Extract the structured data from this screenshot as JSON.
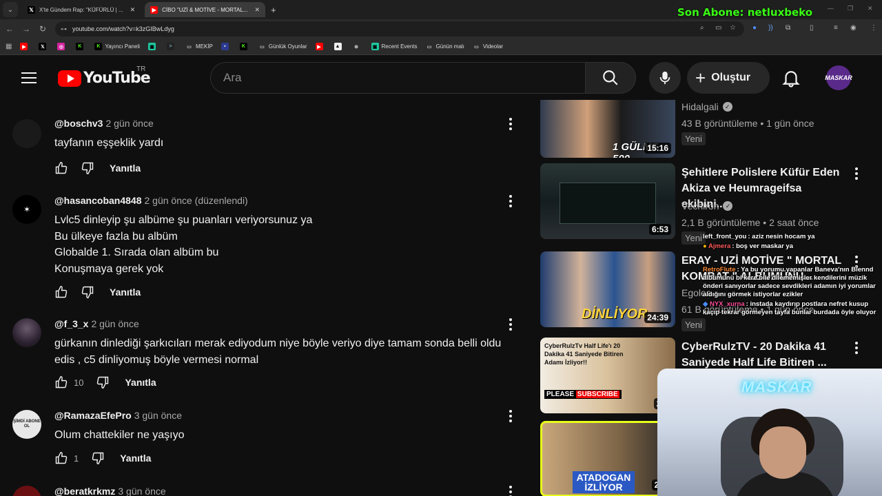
{
  "browser": {
    "tabs": [
      {
        "label": "X'te Gündem Rap: \"KÜFÜRLÜ | ...",
        "icon": "x-logo-icon",
        "active": false
      },
      {
        "label": "CİBO \"UZİ & MOTİVE - MORTAL...",
        "icon": "youtube-icon",
        "active": true
      }
    ],
    "url": "youtube.com/watch?v=k3zGIBwLdyg",
    "overlay_banner": "Son Abone: netluxbeko",
    "bookmarks": [
      {
        "label": "",
        "icon": "youtube-icon"
      },
      {
        "label": "",
        "icon": "x-logo-icon"
      },
      {
        "label": "",
        "icon": "instagram-icon"
      },
      {
        "label": "",
        "icon": "kick-icon"
      },
      {
        "label": "Yayıncı Paneli",
        "icon": "kick-icon"
      },
      {
        "label": "",
        "icon": "app-icon"
      },
      {
        "label": "",
        "icon": "app-icon"
      },
      {
        "label": "MEKİP",
        "icon": "folder-icon"
      },
      {
        "label": "",
        "icon": "app-icon"
      },
      {
        "label": "",
        "icon": "kick-icon"
      },
      {
        "label": "Günlük Oyunlar",
        "icon": "folder-icon"
      },
      {
        "label": "",
        "icon": "youtube-icon"
      },
      {
        "label": "",
        "icon": "app-icon"
      },
      {
        "label": "",
        "icon": "app-icon"
      },
      {
        "label": "Recent Events",
        "icon": "app-icon"
      },
      {
        "label": "Günün malı",
        "icon": "folder-icon"
      },
      {
        "label": "Videolar",
        "icon": "folder-icon"
      }
    ]
  },
  "header": {
    "logo_text": "YouTube",
    "country_code": "TR",
    "search_placeholder": "Ara",
    "create_label": "Oluştur",
    "avatar_text": "MASKAR"
  },
  "comments": [
    {
      "author": "@boschv3",
      "time": "2 gün önce",
      "body": "tayfanın eşşeklik yardı",
      "likes": "",
      "reply": "Yanıtla",
      "avatar": ""
    },
    {
      "author": "@hasancoban4848",
      "time": "2 gün önce (düzenlendi)",
      "body": "Lvlc5 dinleyip şu albüme şu puanları veriyorsunuz ya\nBu ülkeye fazla bu albüm\nGlobalde 1. Sırada olan albüm bu\nKonuşmaya gerek yok",
      "likes": "",
      "reply": "Yanıtla",
      "avatar": "✶"
    },
    {
      "author": "@f_3_x",
      "time": "2 gün önce",
      "body": "gürkanın dinlediği şarkıcıları merak ediyodum niye böyle veriyo diye tamam sonda belli oldu\nedis , c5 dinliyomuş böyle vermesi normal",
      "likes": "10",
      "reply": "Yanıtla",
      "avatar": ""
    },
    {
      "author": "@RamazaEfePro",
      "time": "3 gün önce",
      "body": "Olum chattekiler ne yaşıyo",
      "likes": "1",
      "reply": "Yanıtla",
      "avatar": "ŞİMDİ ABONE OL"
    },
    {
      "author": "@beratkrkmz",
      "time": "3 gün önce",
      "body": "",
      "likes": "",
      "reply": "",
      "avatar": ""
    }
  ],
  "related": [
    {
      "title": "",
      "channel": "Hidalgali",
      "verified": true,
      "meta": "43 B görüntüleme • 1 gün önce",
      "badge": "Yeni",
      "duration": "15:16",
      "thumb_text": "1 GÜLME 500",
      "thumb_color": "#3a4a6a"
    },
    {
      "title": "Şehitlere Polislere Küfür Eden Akiza ve Heumrageifsa ekibini...",
      "channel": "Vechiron",
      "verified": true,
      "meta": "2,1 B görüntüleme • 2 saat önce",
      "badge": "Yeni",
      "duration": "6:53",
      "thumb_text": "",
      "thumb_color": "#1e2a2a"
    },
    {
      "title": "ERAY - UZİ MOTİVE \" MORTAL KOMBAT \" ALBÜMÜNÜ...",
      "channel": "Egolea",
      "verified": false,
      "meta": "61 B görüntüleme • 1 gün önce",
      "badge": "Yeni",
      "duration": "24:39",
      "thumb_text": "DİNLİYOR",
      "thumb_color": "#25406b"
    },
    {
      "title": "CyberRulzTV - 20 Dakika 41 Saniyede Half Life Bitiren ...",
      "channel": "",
      "verified": false,
      "meta": "",
      "badge": "",
      "duration": "22:",
      "thumb_text": "CyberRulzTv Half Life'ı 20 Dakika 41 Saniyede Bitiren Adamı İzliyor!!",
      "thumb_color": "#c7a27a"
    },
    {
      "title": "",
      "channel": "",
      "verified": false,
      "meta": "",
      "badge": "",
      "duration": "24:",
      "thumb_text": "ATADOGAN İZLİYOR",
      "thumb_color": "#a88f68"
    }
  ],
  "chat": [
    {
      "user": "left_front_you",
      "color": "#ffffff",
      "text": "aziz nesin hocam ya"
    },
    {
      "user": "Ajmera",
      "color": "#ff5b5b",
      "text": "boş ver maskar ya"
    },
    {
      "user": "RetroFlute",
      "color": "#ff8c3a",
      "text": "Ya bu yorumu yapanlar Baneva'nın Blennd albümünü bi kere bile dilememişler kendilerini müzik önderi sanıyorlar sadece sevdikleri adamın iyi yorumlar aldığını görmek istiyorlar ezikler"
    },
    {
      "user": "NYX_xurna",
      "color": "#ff4f9a",
      "text": "instada kaydırıp postlara nefret kusup kaçıp tekrar görmeyen tayfa bunlar burdada öyle oluyor"
    }
  ],
  "webcam": {
    "neon_sign": "MASKAR"
  }
}
